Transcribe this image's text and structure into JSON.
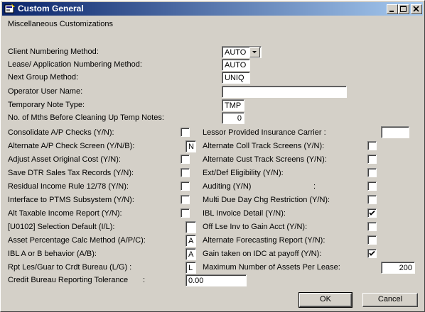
{
  "window": {
    "title": "Custom General"
  },
  "section_heading": "Miscellaneous Customizations",
  "fields": [
    {
      "label": "Client Numbering Method:",
      "value": "AUTO",
      "control": "dropdown"
    },
    {
      "label": "Lease/ Application Numbering Method:",
      "value": "AUTO"
    },
    {
      "label": "Next Group Method:",
      "value": "UNIQ"
    },
    {
      "label": "Operator User Name:",
      "value": ""
    },
    {
      "label": "Temporary Note Type:",
      "value": "TMP"
    },
    {
      "label": "No. of Mths Before Cleaning Up Temp Notes:",
      "value": "0"
    }
  ],
  "left_options": [
    {
      "label": "Consolidate A/P Checks (Y/N):",
      "type": "checkbox",
      "checked": false
    },
    {
      "label": "Alternate A/P Check Screen (Y/N/B):",
      "type": "text",
      "value": "N"
    },
    {
      "label": "Adjust Asset Original Cost (Y/N):",
      "type": "checkbox",
      "checked": false
    },
    {
      "label": "Save DTR Sales Tax Records (Y/N):",
      "type": "checkbox",
      "checked": false
    },
    {
      "label": "Residual Income Rule 12/78 (Y/N):",
      "type": "checkbox",
      "checked": false
    },
    {
      "label": "Interface to PTMS Subsystem (Y/N):",
      "type": "checkbox",
      "checked": false
    },
    {
      "label": "Alt Taxable Income Report (Y/N):",
      "type": "checkbox",
      "checked": false
    },
    {
      "label": "[U0102] Selection Default (I/L):",
      "type": "text",
      "value": ""
    },
    {
      "label": "Asset Percentage Calc Method (A/P/C):",
      "type": "text",
      "value": "A"
    },
    {
      "label": "IBL A or B behavior (A/B):",
      "type": "text",
      "value": "A"
    },
    {
      "label": "Rpt Les/Guar to Crdt Bureau (L/G) :",
      "type": "text",
      "value": "L"
    }
  ],
  "right_options": [
    {
      "label": "Lessor Provided Insurance Carrier :",
      "type": "text",
      "value": ""
    },
    {
      "label": "Alternate Coll Track Screens (Y/N):",
      "type": "checkbox",
      "checked": false
    },
    {
      "label": "Alternate Cust Track Screens (Y/N):",
      "type": "checkbox",
      "checked": false
    },
    {
      "label": "Ext/Def Eligibility (Y/N):",
      "type": "checkbox",
      "checked": false
    },
    {
      "label": "Auditing (Y/N)",
      "label2": ":",
      "type": "checkbox",
      "checked": false
    },
    {
      "label": "Multi Due Day Chg Restriction (Y/N):",
      "type": "checkbox",
      "checked": false
    },
    {
      "label": "IBL Invoice Detail (Y/N):",
      "type": "checkbox",
      "checked": true
    },
    {
      "label": "Off Lse Inv to Gain Acct (Y/N):",
      "type": "checkbox",
      "checked": false
    },
    {
      "label": "Alternate Forecasting Report (Y/N):",
      "type": "checkbox",
      "checked": false
    },
    {
      "label": "Gain taken on IDC at payoff (Y/N):",
      "type": "checkbox",
      "checked": true
    },
    {
      "label": "Maximum Number of Assets Per Lease:",
      "type": "text",
      "value": "200"
    }
  ],
  "tolerance": {
    "label": "Credit Bureau Reporting Tolerance",
    "colon": ":",
    "value": "0.00"
  },
  "buttons": {
    "ok": "OK",
    "cancel": "Cancel"
  }
}
